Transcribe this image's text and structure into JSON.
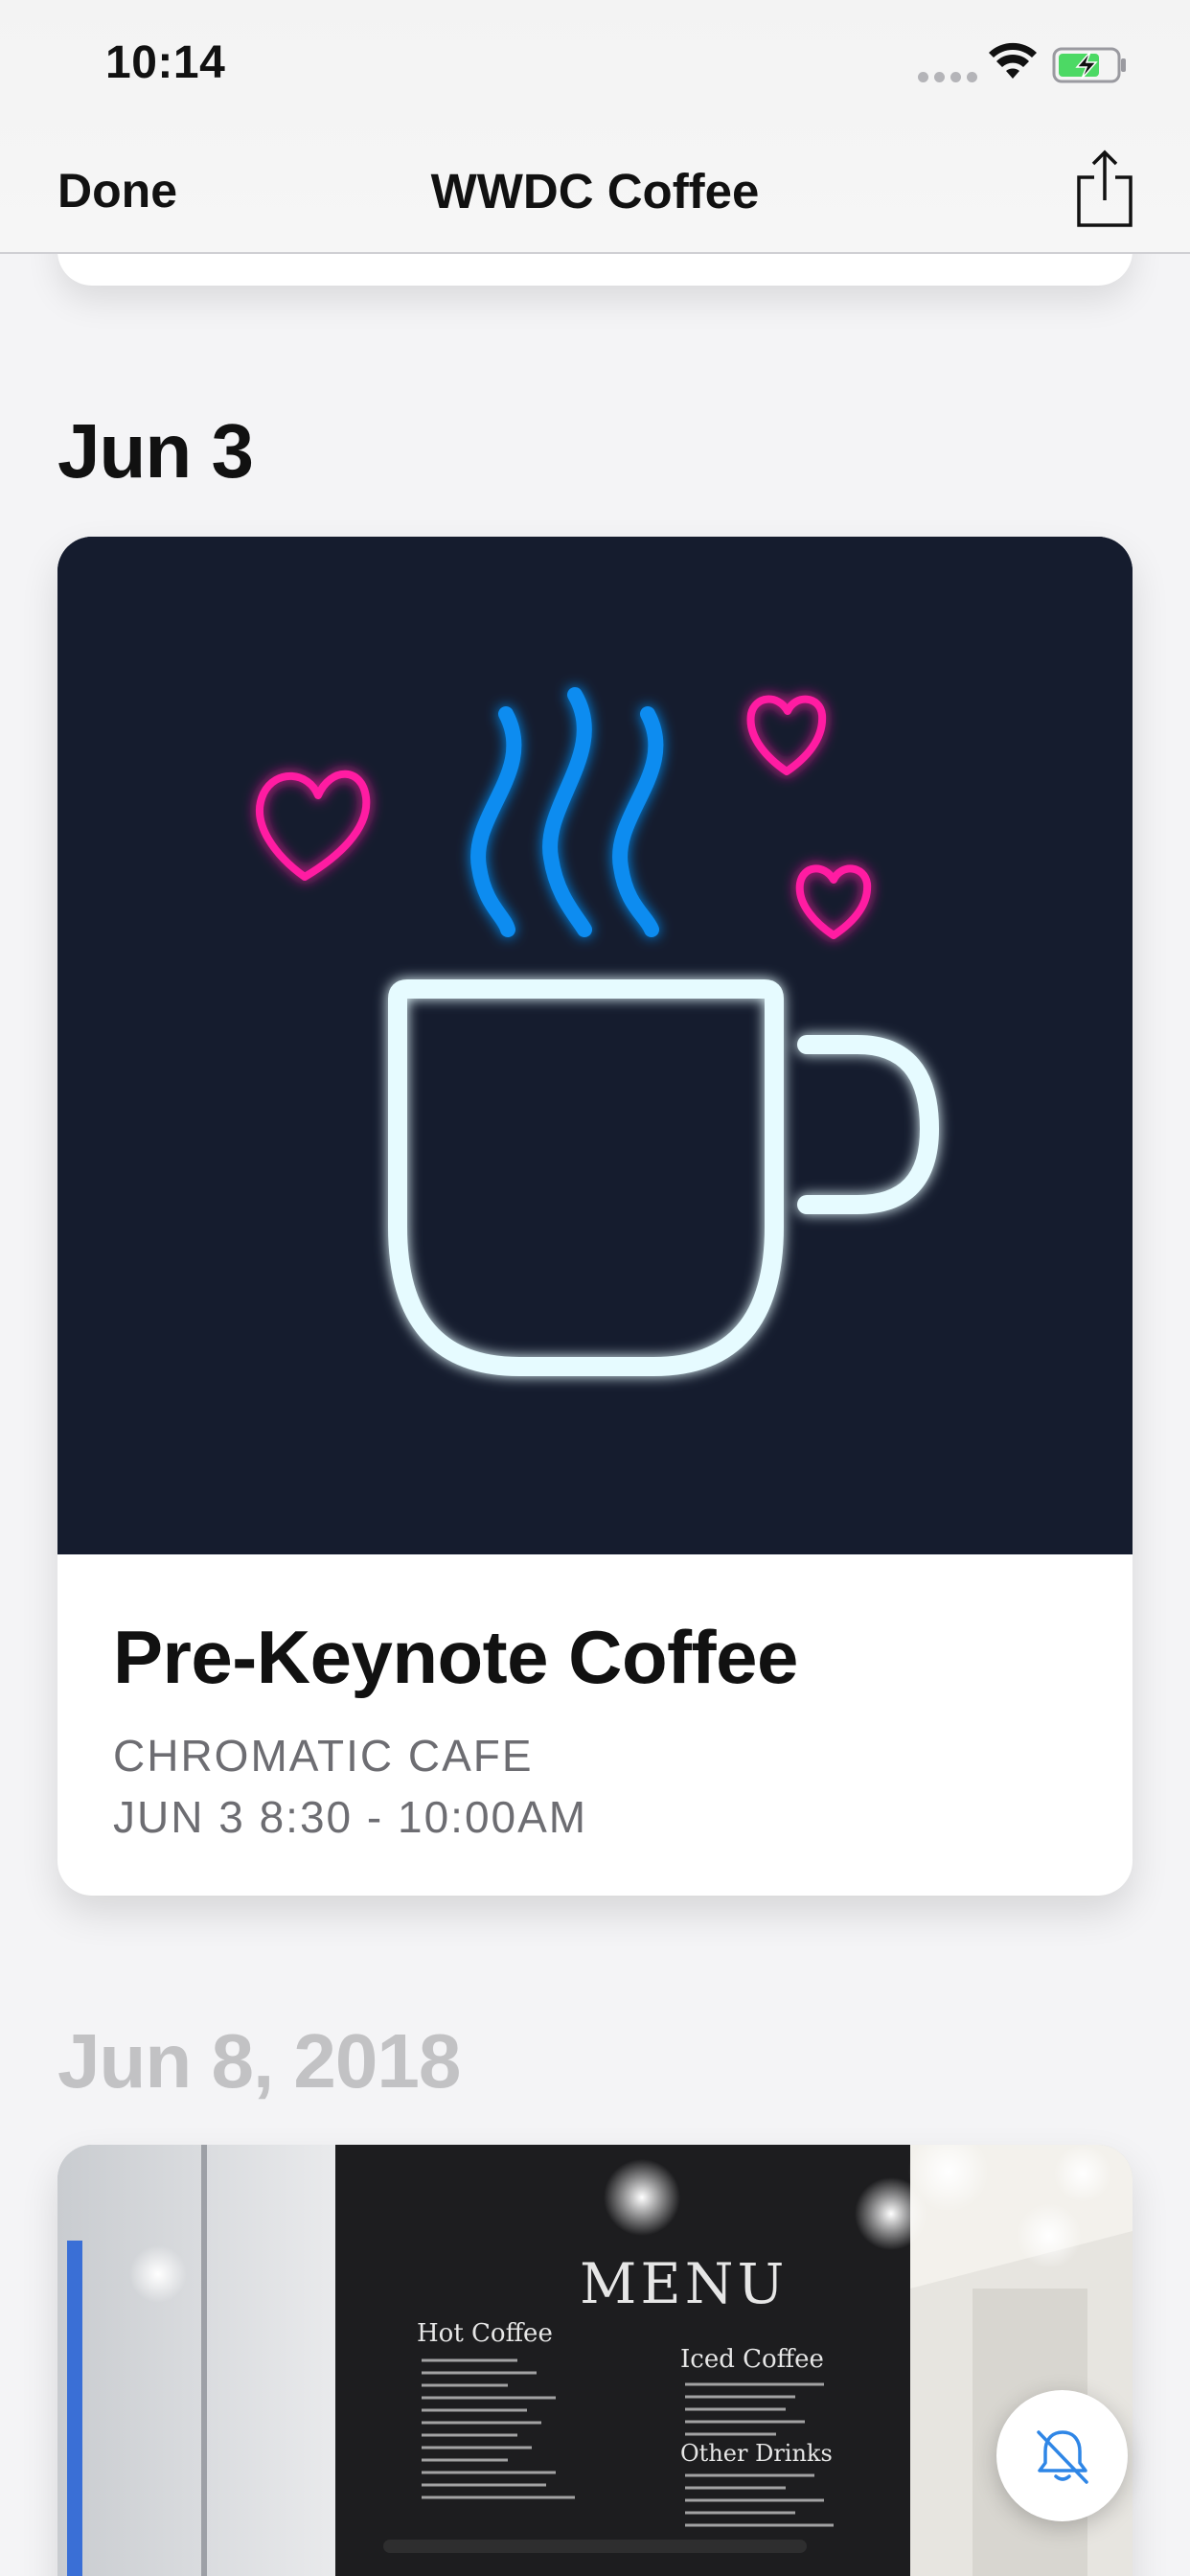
{
  "status_bar": {
    "time": "10:14"
  },
  "nav": {
    "done_label": "Done",
    "title": "WWDC Coffee"
  },
  "sections": [
    {
      "header": "Jun 3",
      "event": {
        "title": "Pre-Keynote Coffee",
        "location": "CHROMATIC CAFE",
        "time": "JUN 3 8:30 - 10:00AM"
      }
    },
    {
      "header": "Jun 8, 2018",
      "menu_board": {
        "heading": "MENU",
        "hot_coffee": "Hot Coffee",
        "iced_coffee": "Iced Coffee",
        "other_drinks": "Other Drinks"
      }
    }
  ],
  "colors": {
    "art_background": "#151c2e",
    "steam_blue": "#0a8cf0",
    "heart_pink": "#ff1aa2",
    "cup_glow": "#e6fbff",
    "accent_blue": "#2f86e6"
  },
  "icons": {
    "share": "share-icon",
    "notifications_off": "bell-slash-icon",
    "wifi": "wifi-icon",
    "battery": "battery-charging-icon"
  }
}
